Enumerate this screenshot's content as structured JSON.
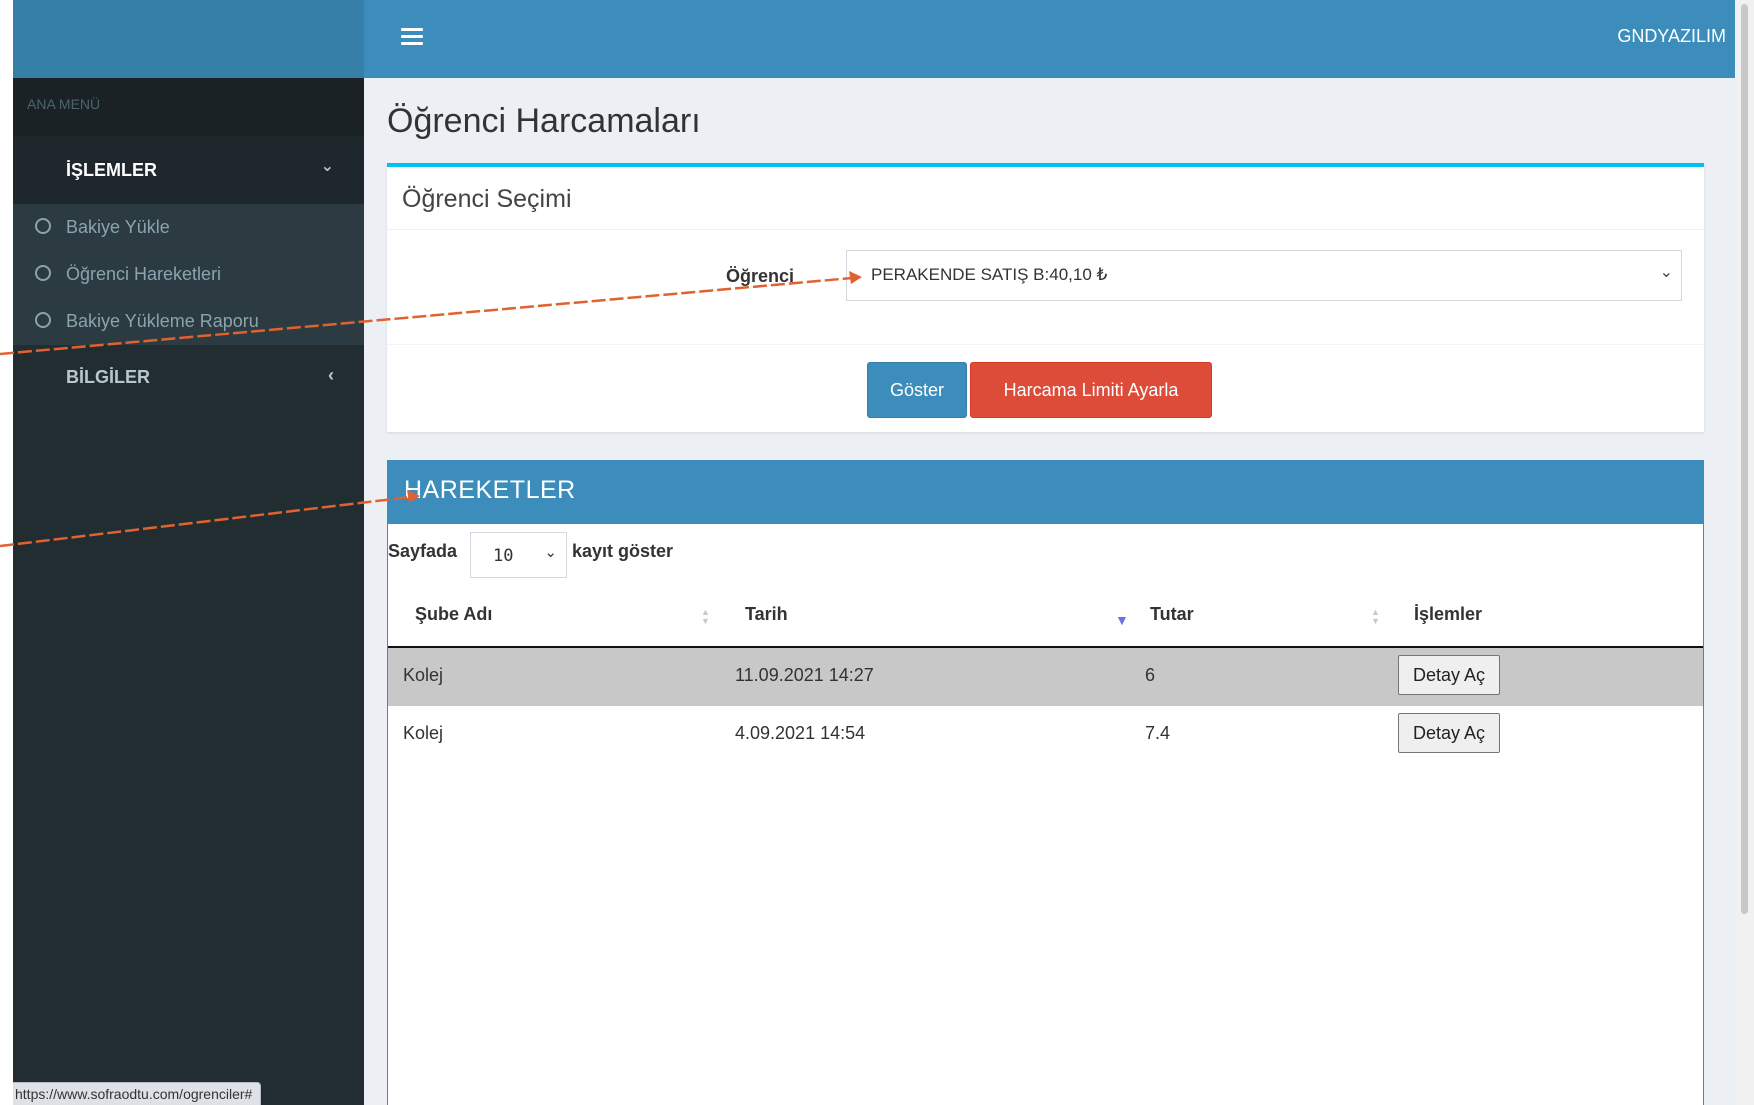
{
  "header": {
    "brand": "GNDYAZILIM"
  },
  "sidebar": {
    "header": "ANA MENÜ",
    "islemler": {
      "label": "İŞLEMLER",
      "items": [
        {
          "label": "Bakiye Yükle"
        },
        {
          "label": "Öğrenci Hareketleri"
        },
        {
          "label": "Bakiye Yükleme Raporu"
        }
      ]
    },
    "bilgiler": {
      "label": "BİLGİLER"
    }
  },
  "status_url": "https://www.sofraodtu.com/ogrenciler#",
  "page": {
    "title": "Öğrenci Harcamaları"
  },
  "selection": {
    "title": "Öğrenci Seçimi",
    "field_label": "Öğrenci",
    "selected": "PERAKENDE SATIŞ B:40,10 ₺",
    "show_button": "Göster",
    "limit_button": "Harcama Limiti Ayarla"
  },
  "movements": {
    "title": "HAREKETLER",
    "length_prefix": "Sayfada",
    "length_value": "10",
    "length_suffix": "kayıt göster",
    "columns": [
      "Şube Adı",
      "Tarih",
      "Tutar",
      "İşlemler"
    ],
    "rows": [
      {
        "sube": "Kolej",
        "tarih": "11.09.2021 14:27",
        "tutar": "6",
        "action": "Detay Aç"
      },
      {
        "sube": "Kolej",
        "tarih": "4.09.2021 14:54",
        "tutar": "7.4",
        "action": "Detay Aç"
      }
    ]
  },
  "colors": {
    "header": "#3c8dbc",
    "sidebar": "#222d32",
    "danger": "#dd4b39",
    "accent_top": "#00c0ef",
    "annotation_arrow": "#e0622e"
  }
}
